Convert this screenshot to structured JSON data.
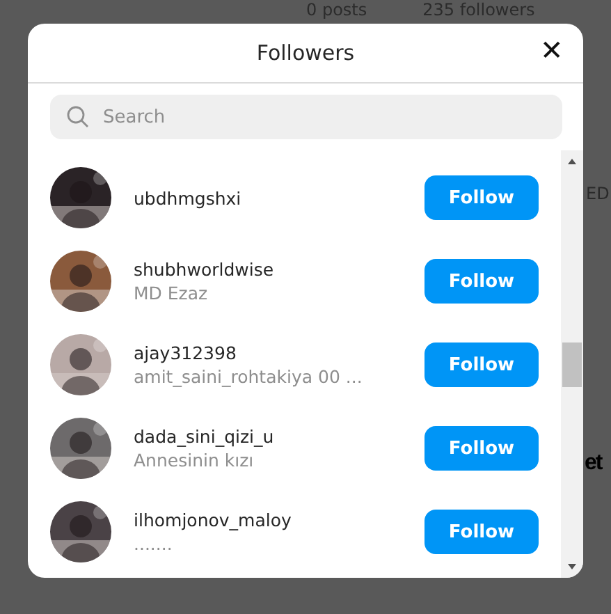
{
  "background": {
    "stats": [
      "0 posts",
      "235 followers"
    ],
    "side_texts": [
      "ED",
      "et"
    ]
  },
  "dialog": {
    "title": "Followers",
    "close": "✕",
    "search": {
      "placeholder": "Search"
    },
    "followers": [
      {
        "username": "ubdhmgshxi",
        "button": "Follow"
      },
      {
        "username": "shubhworldwise",
        "name": "MD Ezaz",
        "button": "Follow"
      },
      {
        "username": "ajay312398",
        "name": "amit_saini_rohtakiya 00 ...",
        "button": "Follow"
      },
      {
        "username": "dada_sini_qizi_u",
        "name": "Annesinin kızı",
        "button": "Follow"
      },
      {
        "username": "ilhomjonov_maloy",
        "name": ".......",
        "button": "Follow"
      }
    ]
  }
}
